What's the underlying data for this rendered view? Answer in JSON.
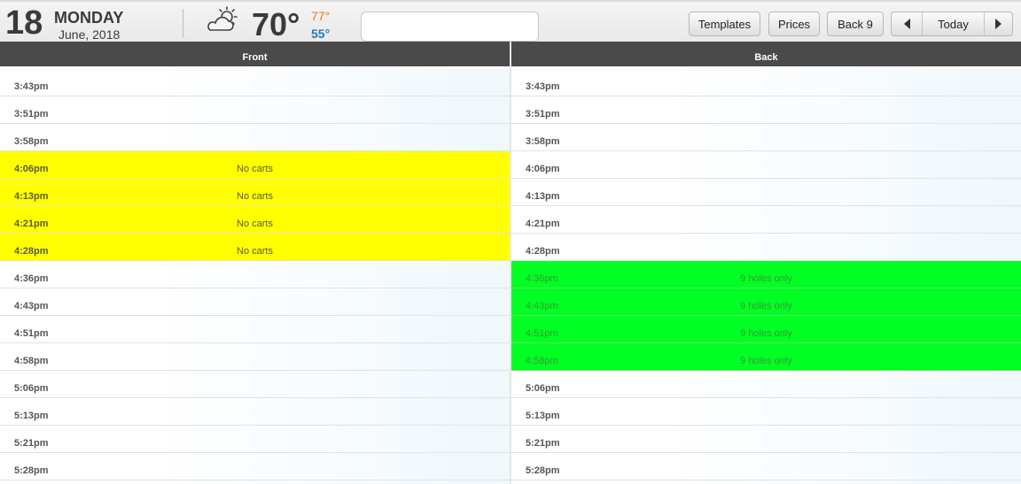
{
  "header": {
    "day_number": "18",
    "day_name": "MONDAY",
    "month_year": "June, 2018",
    "weather_icon": "partly-cloudy-icon",
    "temp_now": "70°",
    "temp_high": "77°",
    "temp_low": "55°",
    "search_value": "",
    "search_placeholder": ""
  },
  "toolbar": {
    "templates_label": "Templates",
    "prices_label": "Prices",
    "back9_label": "Back 9",
    "today_label": "Today"
  },
  "columns": {
    "front_label": "Front",
    "back_label": "Back"
  },
  "front_rows": [
    {
      "time": "3:43pm",
      "note": ""
    },
    {
      "time": "3:51pm",
      "note": ""
    },
    {
      "time": "3:58pm",
      "note": ""
    },
    {
      "time": "4:06pm",
      "note": "No carts"
    },
    {
      "time": "4:13pm",
      "note": "No carts"
    },
    {
      "time": "4:21pm",
      "note": "No carts"
    },
    {
      "time": "4:28pm",
      "note": "No carts"
    },
    {
      "time": "4:36pm",
      "note": ""
    },
    {
      "time": "4:43pm",
      "note": ""
    },
    {
      "time": "4:51pm",
      "note": ""
    },
    {
      "time": "4:58pm",
      "note": ""
    },
    {
      "time": "5:06pm",
      "note": ""
    },
    {
      "time": "5:13pm",
      "note": ""
    },
    {
      "time": "5:21pm",
      "note": ""
    },
    {
      "time": "5:28pm",
      "note": ""
    }
  ],
  "back_rows": [
    {
      "time": "3:43pm",
      "note": ""
    },
    {
      "time": "3:51pm",
      "note": ""
    },
    {
      "time": "3:58pm",
      "note": ""
    },
    {
      "time": "4:06pm",
      "note": ""
    },
    {
      "time": "4:13pm",
      "note": ""
    },
    {
      "time": "4:21pm",
      "note": ""
    },
    {
      "time": "4:28pm",
      "note": ""
    },
    {
      "time": "4:36pm",
      "note": "9 holes only"
    },
    {
      "time": "4:43pm",
      "note": "9 holes only"
    },
    {
      "time": "4:51pm",
      "note": "9 holes only"
    },
    {
      "time": "4:58pm",
      "note": "9 holes only"
    },
    {
      "time": "5:06pm",
      "note": ""
    },
    {
      "time": "5:13pm",
      "note": ""
    },
    {
      "time": "5:21pm",
      "note": ""
    },
    {
      "time": "5:28pm",
      "note": ""
    }
  ],
  "colors": {
    "no_carts": "#ffff00",
    "nine_holes": "#00ff22",
    "header_bar": "#4a4a4a",
    "temp_high": "#e87722",
    "temp_low": "#2a7ab8"
  }
}
